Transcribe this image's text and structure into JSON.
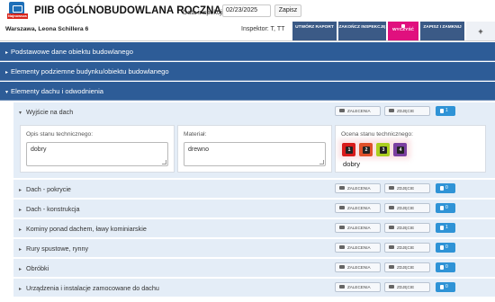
{
  "header": {
    "title": "PIIB OGÓLNOBUDOWLANA ROCZNA",
    "logo_tag": "Najnowsza",
    "date_label": "Data inspekcji:",
    "date_value": "02/23/2025",
    "save_label": "Zapisz"
  },
  "info": {
    "address": "Warszawa, Leona Schillera 6",
    "inspector": "Inspektor: T, TT"
  },
  "actions": {
    "create_report": "UTWÓRZ RAPORT",
    "finish_inspection": "ZAKOŃCZ INSPEKCJĘ",
    "clear": "WYCZYŚĆ",
    "save_close": "ZAPISZ I ZAMKNIJ",
    "add": "+"
  },
  "sections": [
    {
      "label": "Podstawowe dane obiektu budowlanego",
      "expanded": false
    },
    {
      "label": "Elementy podziemne budynku/obiektu budowlanego",
      "expanded": false
    },
    {
      "label": "Elementy dachu i odwodnienia",
      "expanded": true
    }
  ],
  "buttons": {
    "recommendations": "ZALECENIA",
    "photo": "ZDJĘCIE"
  },
  "items": [
    {
      "label": "Wyjście na dach",
      "count": "1",
      "expanded": true
    },
    {
      "label": "Dach - pokrycie",
      "count": "0",
      "expanded": false
    },
    {
      "label": "Dach - konstrukcja",
      "count": "0",
      "expanded": false
    },
    {
      "label": "Kominy ponad dachem, ławy kominiarskie",
      "count": "1",
      "expanded": false
    },
    {
      "label": "Rury spustowe, rynny",
      "count": "0",
      "expanded": false
    },
    {
      "label": "Obróbki",
      "count": "0",
      "expanded": false
    },
    {
      "label": "Urządzenia i instalacje zamocowane do dachu",
      "count": "0",
      "expanded": false
    }
  ],
  "detail": {
    "condition_label": "Opis stanu technicznego:",
    "condition_value": "dobry",
    "material_label": "Materiał:",
    "material_value": "drewno",
    "rating_label": "Ocena stanu technicznego:",
    "rating_options": [
      "1",
      "2",
      "3",
      "4"
    ],
    "rating_colors": [
      "#d81b1b",
      "#e0502a",
      "#aacf1f",
      "#7b3fa0"
    ],
    "rating_value": "dobry"
  }
}
